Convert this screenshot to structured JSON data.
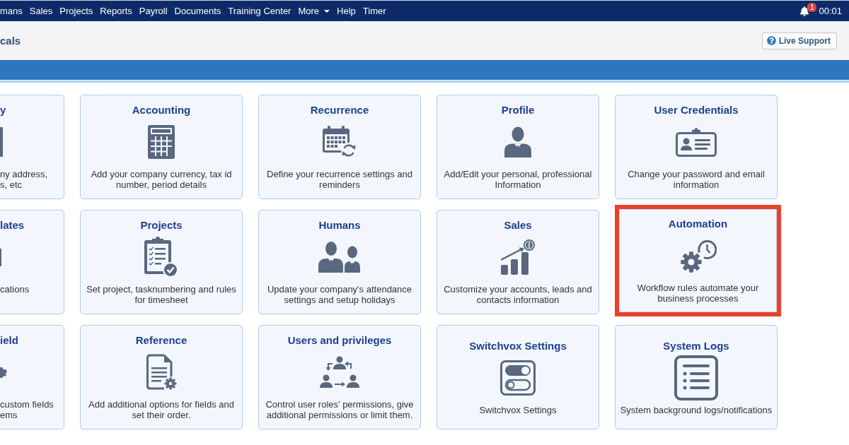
{
  "top_nav": {
    "items": [
      {
        "label": "mans",
        "dropdown": false
      },
      {
        "label": "Sales",
        "dropdown": false
      },
      {
        "label": "Projects",
        "dropdown": false
      },
      {
        "label": "Reports",
        "dropdown": false
      },
      {
        "label": "Payroll",
        "dropdown": false
      },
      {
        "label": "Documents",
        "dropdown": false
      },
      {
        "label": "Training Center",
        "dropdown": false
      },
      {
        "label": "More",
        "dropdown": true
      },
      {
        "label": "Help",
        "dropdown": false
      },
      {
        "label": "Timer",
        "dropdown": false
      }
    ],
    "notification_count": "1",
    "timer": "00:01"
  },
  "header": {
    "title": "cals",
    "live_support_button": "Live Support"
  },
  "cards": [
    {
      "kind": "partial",
      "title": "y",
      "description_lines": [
        "ny address,",
        "s, etc"
      ],
      "highlighted": false
    },
    {
      "kind": "full",
      "title": "Accounting",
      "description": "Add your company currency, tax id number, period details",
      "highlighted": false
    },
    {
      "kind": "full",
      "title": "Recurrence",
      "description": "Define your recurrence settings and reminders",
      "highlighted": false
    },
    {
      "kind": "full",
      "title": "Profile",
      "description": "Add/Edit your personal, professional Information",
      "highlighted": false
    },
    {
      "kind": "full",
      "title": "User Credentials",
      "description": "Change your password and email information",
      "highlighted": false
    },
    {
      "kind": "partial",
      "title": "lates",
      "description_lines": [
        "cations"
      ],
      "highlighted": false
    },
    {
      "kind": "full",
      "title": "Projects",
      "description": "Set project, tasknumbering and rules for timesheet",
      "highlighted": false
    },
    {
      "kind": "full",
      "title": "Humans",
      "description": "Update your company's attendance settings and setup holidays",
      "highlighted": false
    },
    {
      "kind": "full",
      "title": "Sales",
      "description": "Customize your accounts, leads and contacts information",
      "highlighted": false
    },
    {
      "kind": "full",
      "title": "Automation",
      "description": "Workflow rules automate your business processes",
      "highlighted": true
    },
    {
      "kind": "partial",
      "title": "ield",
      "description_lines": [
        "custom fields",
        "ems"
      ],
      "highlighted": false
    },
    {
      "kind": "full",
      "title": "Reference",
      "description": "Add additional options for fields and set their order.",
      "highlighted": false
    },
    {
      "kind": "full",
      "title": "Users and privileges",
      "description": "Control user roles' permissions, give additional permissions or limit them.",
      "highlighted": false
    },
    {
      "kind": "full",
      "title": "Switchvox Settings",
      "description": "Switchvox Settings",
      "highlighted": false
    },
    {
      "kind": "full",
      "title": "System Logs",
      "description": "System background logs/notifications",
      "highlighted": false
    }
  ]
}
